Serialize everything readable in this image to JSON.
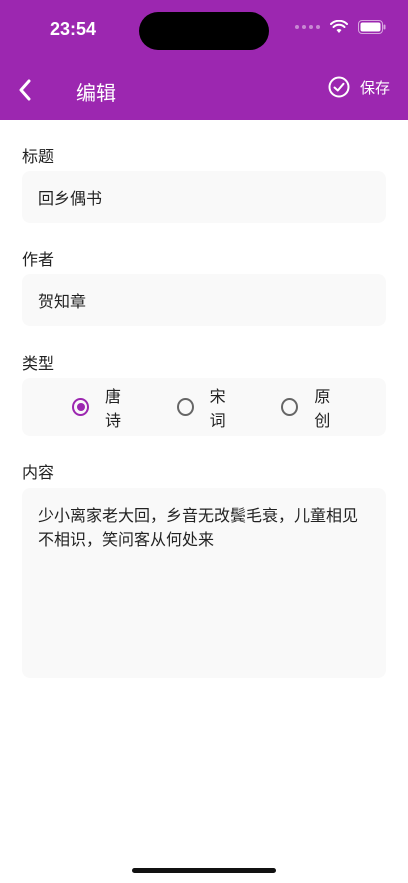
{
  "status_bar": {
    "time": "23:54",
    "icons": [
      "cellular-dots-icon",
      "wifi-icon",
      "battery-icon"
    ]
  },
  "nav": {
    "back_icon": "chevron-left-icon",
    "title": "编辑",
    "save_icon": "check-circle-icon",
    "save_label": "保存"
  },
  "form": {
    "title_label": "标题",
    "title_value": "回乡偶书",
    "author_label": "作者",
    "author_value": "贺知章",
    "type_label": "类型",
    "type_options": [
      {
        "label": "唐诗",
        "selected": true
      },
      {
        "label": "宋词",
        "selected": false
      },
      {
        "label": "原创",
        "selected": false
      }
    ],
    "content_label": "内容",
    "content_value": "少小离家老大回，乡音无改鬓毛衰，儿童相见不相识，笑问客从何处来"
  },
  "colors": {
    "accent": "#9c27b0",
    "field_bg": "#f9f9f9"
  }
}
